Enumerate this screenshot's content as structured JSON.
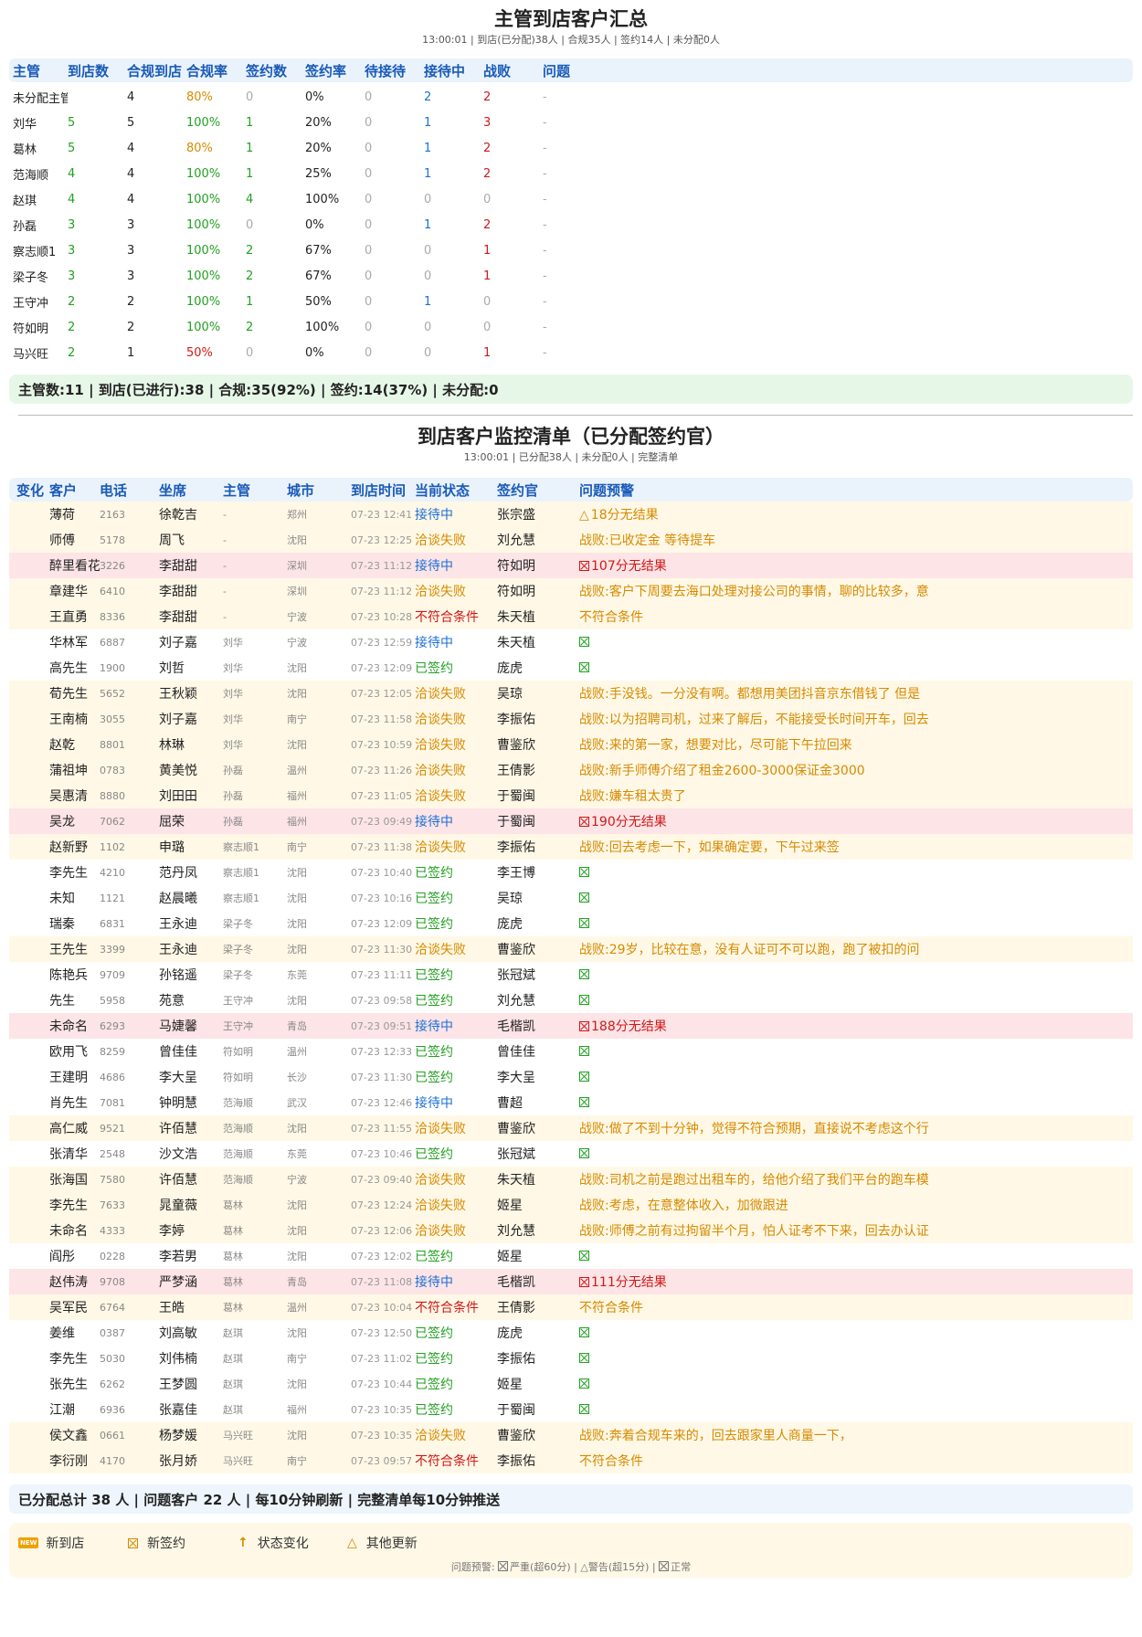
{
  "summary": {
    "title": "主管到店客户汇总",
    "subtitle": "13:00:01 | 到店(已分配)38人 | 合规35人 | 签约14人 | 未分配0人",
    "headers": [
      "主管",
      "到店数",
      "合规到店",
      "合规率",
      "签约数",
      "签约率",
      "待接待",
      "接待中",
      "战败",
      "问题"
    ],
    "rows": [
      [
        "未分配主管",
        "",
        "4",
        "80%",
        "0",
        "0%",
        "0",
        "2",
        "2",
        "-"
      ],
      [
        "刘华",
        "5",
        "5",
        "100%",
        "1",
        "20%",
        "0",
        "1",
        "3",
        "-"
      ],
      [
        "葛林",
        "5",
        "4",
        "80%",
        "1",
        "20%",
        "0",
        "1",
        "2",
        "-"
      ],
      [
        "范海顺",
        "4",
        "4",
        "100%",
        "1",
        "25%",
        "0",
        "1",
        "2",
        "-"
      ],
      [
        "赵琪",
        "4",
        "4",
        "100%",
        "4",
        "100%",
        "0",
        "0",
        "0",
        "-"
      ],
      [
        "孙磊",
        "3",
        "3",
        "100%",
        "0",
        "0%",
        "0",
        "1",
        "2",
        "-"
      ],
      [
        "察志顺1",
        "3",
        "3",
        "100%",
        "2",
        "67%",
        "0",
        "0",
        "1",
        "-"
      ],
      [
        "梁子冬",
        "3",
        "3",
        "100%",
        "2",
        "67%",
        "0",
        "0",
        "1",
        "-"
      ],
      [
        "王守冲",
        "2",
        "2",
        "100%",
        "1",
        "50%",
        "0",
        "1",
        "0",
        "-"
      ],
      [
        "符如明",
        "2",
        "2",
        "100%",
        "2",
        "100%",
        "0",
        "0",
        "0",
        "-"
      ],
      [
        "马兴旺",
        "2",
        "1",
        "50%",
        "0",
        "0%",
        "0",
        "0",
        "1",
        "-"
      ]
    ],
    "footer": "主管数:11 | 到店(已进行):38 | 合规:35(92%) | 签约:14(37%) | 未分配:0"
  },
  "monitor": {
    "title": "到店客户监控清单（已分配签约官）",
    "subtitle": "13:00:01 | 已分配38人 | 未分配0人 | 完整清单",
    "headers": [
      "变化",
      "客户",
      "电话",
      "坐席",
      "主管",
      "城市",
      "到店时间",
      "当前状态",
      "签约官",
      "问题预警"
    ],
    "rows": [
      {
        "change": "",
        "customer": "薄荷",
        "phone": "2163",
        "agent": "徐乾吉",
        "manager": "-",
        "city": "郑州",
        "time": "07-23 12:41",
        "status": "接待中",
        "officer": "张宗盛",
        "warning": "18分无结果",
        "wicon": "tri",
        "row": "warn"
      },
      {
        "change": "",
        "customer": "师傅",
        "phone": "5178",
        "agent": "周飞",
        "manager": "-",
        "city": "沈阳",
        "time": "07-23 12:25",
        "status": "洽谈失败",
        "officer": "刘允慧",
        "warning": "战败:已收定金 等待提车",
        "wicon": "",
        "row": "warn"
      },
      {
        "change": "",
        "customer": "醉里看花",
        "phone": "3226",
        "agent": "李甜甜",
        "manager": "-",
        "city": "深圳",
        "time": "07-23 11:12",
        "status": "接待中",
        "officer": "符如明",
        "warning": "107分无结果",
        "wicon": "box",
        "row": "alert"
      },
      {
        "change": "",
        "customer": "章建华",
        "phone": "6410",
        "agent": "李甜甜",
        "manager": "-",
        "city": "深圳",
        "time": "07-23 11:12",
        "status": "洽谈失败",
        "officer": "符如明",
        "warning": "战败:客户下周要去海口处理对接公司的事情，聊的比较多，意",
        "wicon": "",
        "row": "warn"
      },
      {
        "change": "",
        "customer": "王直勇",
        "phone": "8336",
        "agent": "李甜甜",
        "manager": "-",
        "city": "宁波",
        "time": "07-23 10:28",
        "status": "不符合条件",
        "officer": "朱天植",
        "warning": "不符合条件",
        "wicon": "",
        "row": "warn"
      },
      {
        "change": "",
        "customer": "华林军",
        "phone": "6887",
        "agent": "刘子嘉",
        "manager": "刘华",
        "city": "宁波",
        "time": "07-23 12:59",
        "status": "接待中",
        "officer": "朱天植",
        "warning": "",
        "wicon": "box",
        "row": ""
      },
      {
        "change": "",
        "customer": "高先生",
        "phone": "1900",
        "agent": "刘哲",
        "manager": "刘华",
        "city": "沈阳",
        "time": "07-23 12:09",
        "status": "已签约",
        "officer": "庞虎",
        "warning": "",
        "wicon": "box",
        "row": ""
      },
      {
        "change": "",
        "customer": "荀先生",
        "phone": "5652",
        "agent": "王秋颖",
        "manager": "刘华",
        "city": "沈阳",
        "time": "07-23 12:05",
        "status": "洽谈失败",
        "officer": "吴琼",
        "warning": "战败:手没钱。一分没有啊。都想用美团抖音京东借钱了 但是",
        "wicon": "",
        "row": "warn"
      },
      {
        "change": "",
        "customer": "王南楠",
        "phone": "3055",
        "agent": "刘子嘉",
        "manager": "刘华",
        "city": "南宁",
        "time": "07-23 11:58",
        "status": "洽谈失败",
        "officer": "李振佑",
        "warning": "战败:以为招聘司机，过来了解后，不能接受长时间开车，回去",
        "wicon": "",
        "row": "warn"
      },
      {
        "change": "",
        "customer": "赵乾",
        "phone": "8801",
        "agent": "林琳",
        "manager": "刘华",
        "city": "沈阳",
        "time": "07-23 10:59",
        "status": "洽谈失败",
        "officer": "曹鉴欣",
        "warning": "战败:来的第一家，想要对比，尽可能下午拉回来",
        "wicon": "",
        "row": "warn"
      },
      {
        "change": "",
        "customer": "蒲祖坤",
        "phone": "0783",
        "agent": "黄美悦",
        "manager": "孙磊",
        "city": "温州",
        "time": "07-23 11:26",
        "status": "洽谈失败",
        "officer": "王倩影",
        "warning": "战败:新手师傅介绍了租金2600-3000保证金3000",
        "wicon": "",
        "row": "warn"
      },
      {
        "change": "",
        "customer": "吴惠清",
        "phone": "8880",
        "agent": "刘田田",
        "manager": "孙磊",
        "city": "福州",
        "time": "07-23 11:05",
        "status": "洽谈失败",
        "officer": "于蜀闽",
        "warning": "战败:嫌车租太贵了",
        "wicon": "",
        "row": "warn"
      },
      {
        "change": "",
        "customer": "吴龙",
        "phone": "7062",
        "agent": "屈荣",
        "manager": "孙磊",
        "city": "福州",
        "time": "07-23 09:49",
        "status": "接待中",
        "officer": "于蜀闽",
        "warning": "190分无结果",
        "wicon": "box",
        "row": "alert"
      },
      {
        "change": "",
        "customer": "赵新野",
        "phone": "1102",
        "agent": "申璐",
        "manager": "察志顺1",
        "city": "南宁",
        "time": "07-23 11:38",
        "status": "洽谈失败",
        "officer": "李振佑",
        "warning": "战败:回去考虑一下，如果确定要，下午过来签",
        "wicon": "",
        "row": "warn"
      },
      {
        "change": "",
        "customer": "李先生",
        "phone": "4210",
        "agent": "范丹凤",
        "manager": "察志顺1",
        "city": "沈阳",
        "time": "07-23 10:40",
        "status": "已签约",
        "officer": "李王博",
        "warning": "",
        "wicon": "box",
        "row": ""
      },
      {
        "change": "",
        "customer": "未知",
        "phone": "1121",
        "agent": "赵晨曦",
        "manager": "察志顺1",
        "city": "沈阳",
        "time": "07-23 10:16",
        "status": "已签约",
        "officer": "吴琼",
        "warning": "",
        "wicon": "box",
        "row": ""
      },
      {
        "change": "",
        "customer": "瑞秦",
        "phone": "6831",
        "agent": "王永迪",
        "manager": "梁子冬",
        "city": "沈阳",
        "time": "07-23 12:09",
        "status": "已签约",
        "officer": "庞虎",
        "warning": "",
        "wicon": "box",
        "row": ""
      },
      {
        "change": "",
        "customer": "王先生",
        "phone": "3399",
        "agent": "王永迪",
        "manager": "梁子冬",
        "city": "沈阳",
        "time": "07-23 11:30",
        "status": "洽谈失败",
        "officer": "曹鉴欣",
        "warning": "战败:29岁，比较在意，没有人证可不可以跑，跑了被扣的问",
        "wicon": "",
        "row": "warn"
      },
      {
        "change": "",
        "customer": "陈艳兵",
        "phone": "9709",
        "agent": "孙铭遥",
        "manager": "梁子冬",
        "city": "东莞",
        "time": "07-23 11:11",
        "status": "已签约",
        "officer": "张冠斌",
        "warning": "",
        "wicon": "box",
        "row": ""
      },
      {
        "change": "",
        "customer": "先生",
        "phone": "5958",
        "agent": "苑意",
        "manager": "王守冲",
        "city": "沈阳",
        "time": "07-23 09:58",
        "status": "已签约",
        "officer": "刘允慧",
        "warning": "",
        "wicon": "box",
        "row": ""
      },
      {
        "change": "",
        "customer": "未命名",
        "phone": "6293",
        "agent": "马婕馨",
        "manager": "王守冲",
        "city": "青岛",
        "time": "07-23 09:51",
        "status": "接待中",
        "officer": "毛楷凯",
        "warning": "188分无结果",
        "wicon": "box",
        "row": "alert"
      },
      {
        "change": "",
        "customer": "欧用飞",
        "phone": "8259",
        "agent": "曾佳佳",
        "manager": "符如明",
        "city": "温州",
        "time": "07-23 12:33",
        "status": "已签约",
        "officer": "曾佳佳",
        "warning": "",
        "wicon": "box",
        "row": ""
      },
      {
        "change": "",
        "customer": "王建明",
        "phone": "4686",
        "agent": "李大呈",
        "manager": "符如明",
        "city": "长沙",
        "time": "07-23 11:30",
        "status": "已签约",
        "officer": "李大呈",
        "warning": "",
        "wicon": "box",
        "row": ""
      },
      {
        "change": "",
        "customer": "肖先生",
        "phone": "7081",
        "agent": "钟明慧",
        "manager": "范海顺",
        "city": "武汉",
        "time": "07-23 12:46",
        "status": "接待中",
        "officer": "曹超",
        "warning": "",
        "wicon": "box",
        "row": ""
      },
      {
        "change": "",
        "customer": "高仁威",
        "phone": "9521",
        "agent": "许佰慧",
        "manager": "范海顺",
        "city": "沈阳",
        "time": "07-23 11:55",
        "status": "洽谈失败",
        "officer": "曹鉴欣",
        "warning": "战败:做了不到十分钟，觉得不符合预期，直接说不考虑这个行",
        "wicon": "",
        "row": "warn"
      },
      {
        "change": "",
        "customer": "张清华",
        "phone": "2548",
        "agent": "沙文浩",
        "manager": "范海顺",
        "city": "东莞",
        "time": "07-23 10:46",
        "status": "已签约",
        "officer": "张冠斌",
        "warning": "",
        "wicon": "box",
        "row": ""
      },
      {
        "change": "",
        "customer": "张海国",
        "phone": "7580",
        "agent": "许佰慧",
        "manager": "范海顺",
        "city": "宁波",
        "time": "07-23 09:40",
        "status": "洽谈失败",
        "officer": "朱天植",
        "warning": "战败:司机之前是跑过出租车的，给他介绍了我们平台的跑车模",
        "wicon": "",
        "row": "warn"
      },
      {
        "change": "",
        "customer": "李先生",
        "phone": "7633",
        "agent": "晁童薇",
        "manager": "葛林",
        "city": "沈阳",
        "time": "07-23 12:24",
        "status": "洽谈失败",
        "officer": "姬星",
        "warning": "战败:考虑，在意整体收入，加微跟进",
        "wicon": "",
        "row": "warn"
      },
      {
        "change": "",
        "customer": "未命名",
        "phone": "4333",
        "agent": "李婷",
        "manager": "葛林",
        "city": "沈阳",
        "time": "07-23 12:06",
        "status": "洽谈失败",
        "officer": "刘允慧",
        "warning": "战败:师傅之前有过拘留半个月，怕人证考不下来，回去办认证",
        "wicon": "",
        "row": "warn"
      },
      {
        "change": "",
        "customer": "阎彤",
        "phone": "0228",
        "agent": "李若男",
        "manager": "葛林",
        "city": "沈阳",
        "time": "07-23 12:02",
        "status": "已签约",
        "officer": "姬星",
        "warning": "",
        "wicon": "box",
        "row": ""
      },
      {
        "change": "",
        "customer": "赵伟涛",
        "phone": "9708",
        "agent": "严梦涵",
        "manager": "葛林",
        "city": "青岛",
        "time": "07-23 11:08",
        "status": "接待中",
        "officer": "毛楷凯",
        "warning": "111分无结果",
        "wicon": "box",
        "row": "alert"
      },
      {
        "change": "",
        "customer": "吴军民",
        "phone": "6764",
        "agent": "王皓",
        "manager": "葛林",
        "city": "温州",
        "time": "07-23 10:04",
        "status": "不符合条件",
        "officer": "王倩影",
        "warning": "不符合条件",
        "wicon": "",
        "row": "warn"
      },
      {
        "change": "",
        "customer": "姜维",
        "phone": "0387",
        "agent": "刘高敏",
        "manager": "赵琪",
        "city": "沈阳",
        "time": "07-23 12:50",
        "status": "已签约",
        "officer": "庞虎",
        "warning": "",
        "wicon": "box",
        "row": ""
      },
      {
        "change": "",
        "customer": "李先生",
        "phone": "5030",
        "agent": "刘伟楠",
        "manager": "赵琪",
        "city": "南宁",
        "time": "07-23 11:02",
        "status": "已签约",
        "officer": "李振佑",
        "warning": "",
        "wicon": "box",
        "row": ""
      },
      {
        "change": "",
        "customer": "张先生",
        "phone": "6262",
        "agent": "王梦圆",
        "manager": "赵琪",
        "city": "沈阳",
        "time": "07-23 10:44",
        "status": "已签约",
        "officer": "姬星",
        "warning": "",
        "wicon": "box",
        "row": ""
      },
      {
        "change": "",
        "customer": "江潮",
        "phone": "6936",
        "agent": "张嘉佳",
        "manager": "赵琪",
        "city": "福州",
        "time": "07-23 10:35",
        "status": "已签约",
        "officer": "于蜀闽",
        "warning": "",
        "wicon": "box",
        "row": ""
      },
      {
        "change": "",
        "customer": "侯文鑫",
        "phone": "0661",
        "agent": "杨梦媛",
        "manager": "马兴旺",
        "city": "沈阳",
        "time": "07-23 10:35",
        "status": "洽谈失败",
        "officer": "曹鉴欣",
        "warning": "战败:奔着合规车来的，回去跟家里人商量一下，",
        "wicon": "",
        "row": "warn"
      },
      {
        "change": "",
        "customer": "李衍刚",
        "phone": "4170",
        "agent": "张月娇",
        "manager": "马兴旺",
        "city": "南宁",
        "time": "07-23 09:57",
        "status": "不符合条件",
        "officer": "李振佑",
        "warning": "不符合条件",
        "wicon": "",
        "row": "warn"
      }
    ],
    "footer": "已分配总计 38 人 | 问题客户 22 人 | 每10分钟刷新 | 完整清单每10分钟推送"
  },
  "legend": {
    "new_badge": "NEW",
    "items": [
      "新到店",
      "新签约",
      "状态变化",
      "其他更新"
    ],
    "arrow_glyph": "↑",
    "triangle_glyph": "△",
    "note_prefix": "问题预警: ",
    "note_severe": "严重(超60分)",
    "note_sep1": " | ",
    "note_warning": "警告(超15分)",
    "note_sep2": " | ",
    "note_normal": "正常"
  },
  "colors": {
    "header_blue": "#1a5ab8",
    "green": "#22a022",
    "orange": "#d68a00",
    "red": "#d01818",
    "blue": "#1a6fd8"
  }
}
